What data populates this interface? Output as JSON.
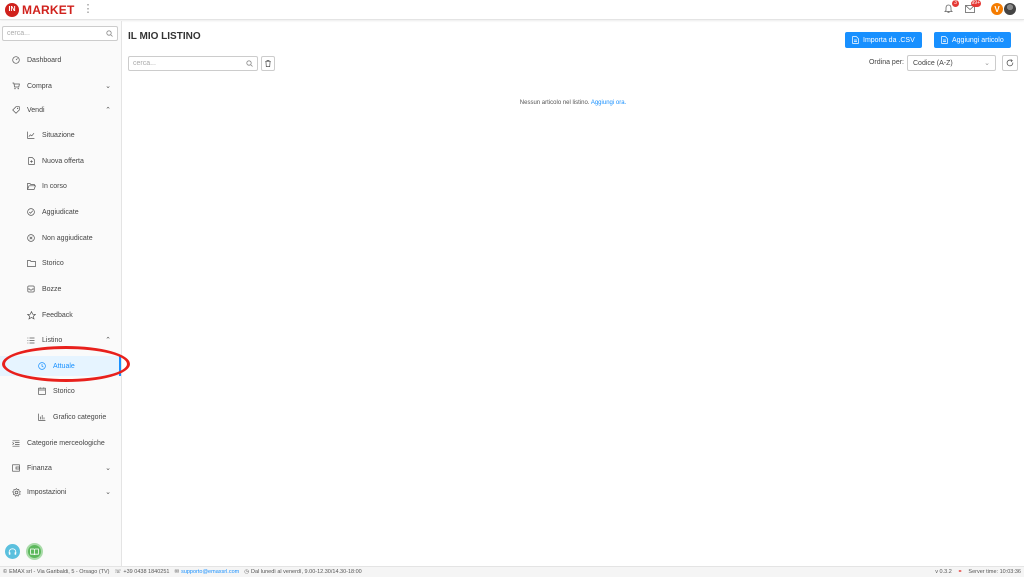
{
  "app": {
    "logo_mark": "IN",
    "logo_text": "MARKET",
    "more_icon": "kebab-vertical-icon"
  },
  "top_right": {
    "notifications_badge": "3",
    "messages_badge": "99+",
    "user_initial": "V"
  },
  "sidebar": {
    "search_placeholder": "cerca...",
    "items": [
      {
        "label": "Dashboard",
        "icon": "dashboard-icon"
      },
      {
        "label": "Compra",
        "icon": "cart-icon",
        "chevron": "⌄"
      },
      {
        "label": "Vendi",
        "icon": "tag-icon",
        "chevron": "⌃"
      },
      {
        "label": "Situazione",
        "icon": "line-chart-icon"
      },
      {
        "label": "Nuova offerta",
        "icon": "file-add-icon"
      },
      {
        "label": "In corso",
        "icon": "folder-open-icon"
      },
      {
        "label": "Aggiudicate",
        "icon": "check-circle-icon"
      },
      {
        "label": "Non aggiudicate",
        "icon": "close-circle-icon"
      },
      {
        "label": "Storico",
        "icon": "folder-icon"
      },
      {
        "label": "Bozze",
        "icon": "inbox-icon"
      },
      {
        "label": "Feedback",
        "icon": "star-icon"
      },
      {
        "label": "Listino",
        "icon": "list-icon",
        "chevron": "⌃"
      },
      {
        "label": "Attuale",
        "icon": "clock-circle-icon"
      },
      {
        "label": "Storico",
        "icon": "calendar-icon"
      },
      {
        "label": "Grafico categorie",
        "icon": "bar-chart-icon"
      },
      {
        "label": "Categorie merceologiche",
        "icon": "menu-fold-icon"
      },
      {
        "label": "Finanza",
        "icon": "wallet-icon",
        "chevron": "⌄"
      },
      {
        "label": "Impostazioni",
        "icon": "setting-icon",
        "chevron": "⌄"
      }
    ]
  },
  "main": {
    "title": "IL MIO LISTINO",
    "import_button": "Importa da .CSV",
    "add_button": "Aggiungi articolo",
    "search_placeholder": "cerca...",
    "sort_label": "Ordina per:",
    "sort_value": "Codice (A-Z)",
    "empty_text": "Nessun articolo nel listino.",
    "empty_link": "Aggiungi ora."
  },
  "footer": {
    "company": "EMAX srl - Via Garibaldi, 5 - Orsago (TV)",
    "phone": "+39 0438 1840251",
    "email": "supporto@emaxsrl.com",
    "hours": "Dal lunedì al venerdì, 9.00-12.30/14.30-18:00",
    "version": "v 0.3.2",
    "server_time": "Server time: 10:03:36"
  },
  "colors": {
    "brand": "#d0211c",
    "primary": "#1890ff",
    "annotation": "#e8201c"
  }
}
